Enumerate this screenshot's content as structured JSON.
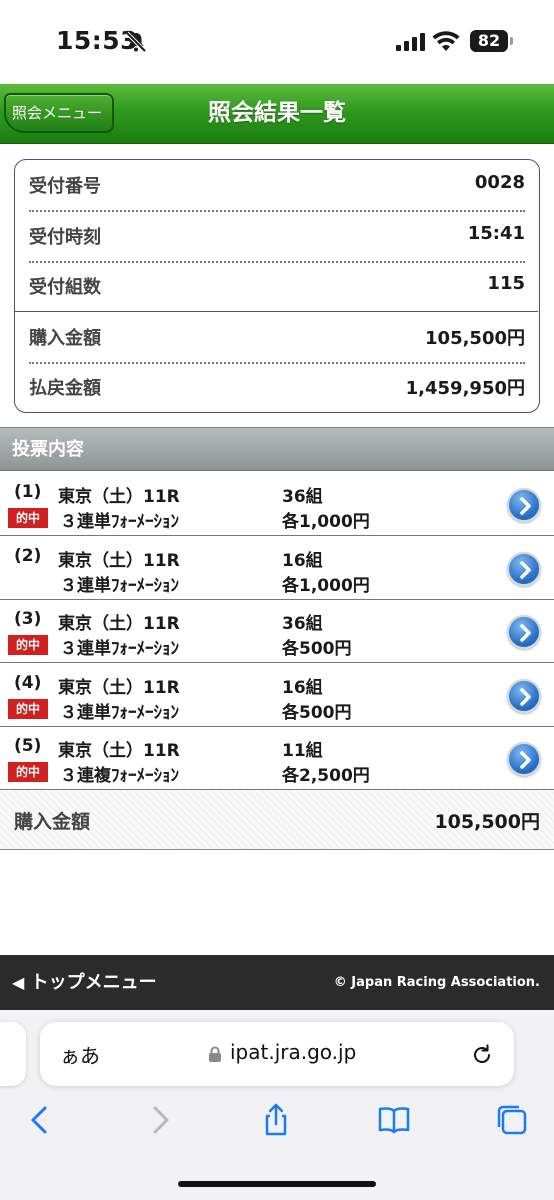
{
  "status": {
    "time": "15:53",
    "battery": "82"
  },
  "header": {
    "back_label": "照会メニュー",
    "title": "照会結果一覧"
  },
  "summary": {
    "rows": [
      {
        "label": "受付番号",
        "value": "0028"
      },
      {
        "label": "受付時刻",
        "value": "15:41"
      },
      {
        "label": "受付組数",
        "value": "115"
      },
      {
        "label": "購入金額",
        "value": "105,500円"
      },
      {
        "label": "払戻金額",
        "value": "1,459,950円"
      }
    ]
  },
  "votes": {
    "heading": "投票内容",
    "hit_label": "的中",
    "items": [
      {
        "num": "(1)",
        "race": "東京（土）11R",
        "kind": "３連単ﾌｫｰﾒｰｼｮﾝ",
        "count": "36組",
        "amount": "各1,000円",
        "hit": true
      },
      {
        "num": "(2)",
        "race": "東京（土）11R",
        "kind": "３連単ﾌｫｰﾒｰｼｮﾝ",
        "count": "16組",
        "amount": "各1,000円",
        "hit": false
      },
      {
        "num": "(3)",
        "race": "東京（土）11R",
        "kind": "３連単ﾌｫｰﾒｰｼｮﾝ",
        "count": "36組",
        "amount": "各500円",
        "hit": true
      },
      {
        "num": "(4)",
        "race": "東京（土）11R",
        "kind": "３連単ﾌｫｰﾒｰｼｮﾝ",
        "count": "16組",
        "amount": "各500円",
        "hit": true
      },
      {
        "num": "(5)",
        "race": "東京（土）11R",
        "kind": "３連複ﾌｫｰﾒｰｼｮﾝ",
        "count": "11組",
        "amount": "各2,500円",
        "hit": true
      }
    ]
  },
  "total": {
    "label": "購入金額",
    "value": "105,500円"
  },
  "footer": {
    "top_menu": "トップメニュー",
    "copyright": "© Japan Racing Association."
  },
  "browser": {
    "aa": "ぁあ",
    "host": "ipat.jra.go.jp"
  },
  "colors": {
    "header_green": "#2f9a1e",
    "hit_red": "#d22020",
    "arrow_blue": "#1f6ac4",
    "ios_blue": "#1a7cf5"
  }
}
